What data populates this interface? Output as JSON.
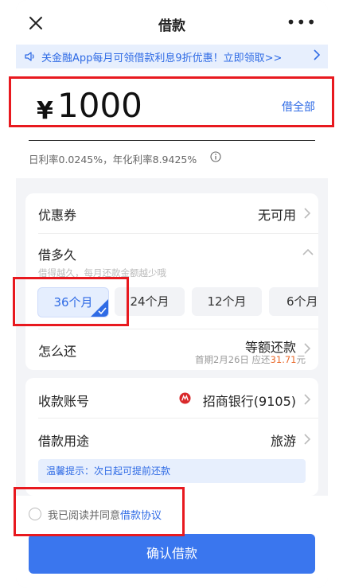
{
  "header": {
    "title": "借款"
  },
  "notice": {
    "text": "关金融App每月可领借款利息9折优惠！立即领取>>"
  },
  "amount": {
    "currency": "¥",
    "value": "1000",
    "borrow_all": "借全部",
    "rate_text": "日利率0.0245%，年化利率8.9425%"
  },
  "coupon": {
    "label": "优惠券",
    "value": "无可用"
  },
  "term": {
    "label": "借多久",
    "hint": "借得越久，每月还款金额越少哦",
    "options": [
      "36个月",
      "24个月",
      "12个月",
      "6个月"
    ],
    "selected_index": 0
  },
  "repay": {
    "label": "怎么还",
    "value": "等额还款",
    "sub_prefix": "首期2月26日 应还",
    "sub_amount": "31.71",
    "sub_suffix": "元"
  },
  "account": {
    "label": "收款账号",
    "value": "招商银行(9105)"
  },
  "purpose": {
    "label": "借款用途",
    "value": "旅游"
  },
  "tip": {
    "text": "温馨提示：次日起可提前还款"
  },
  "agreement": {
    "prefix": "我已阅读并同意",
    "link": "借款协议"
  },
  "confirm": {
    "label": "确认借款"
  },
  "colors": {
    "accent": "#2f6be5",
    "button": "#3a76ee",
    "highlight": "#e8191f",
    "amount_orange": "#e96a2c",
    "bank_red": "#d9282a"
  }
}
